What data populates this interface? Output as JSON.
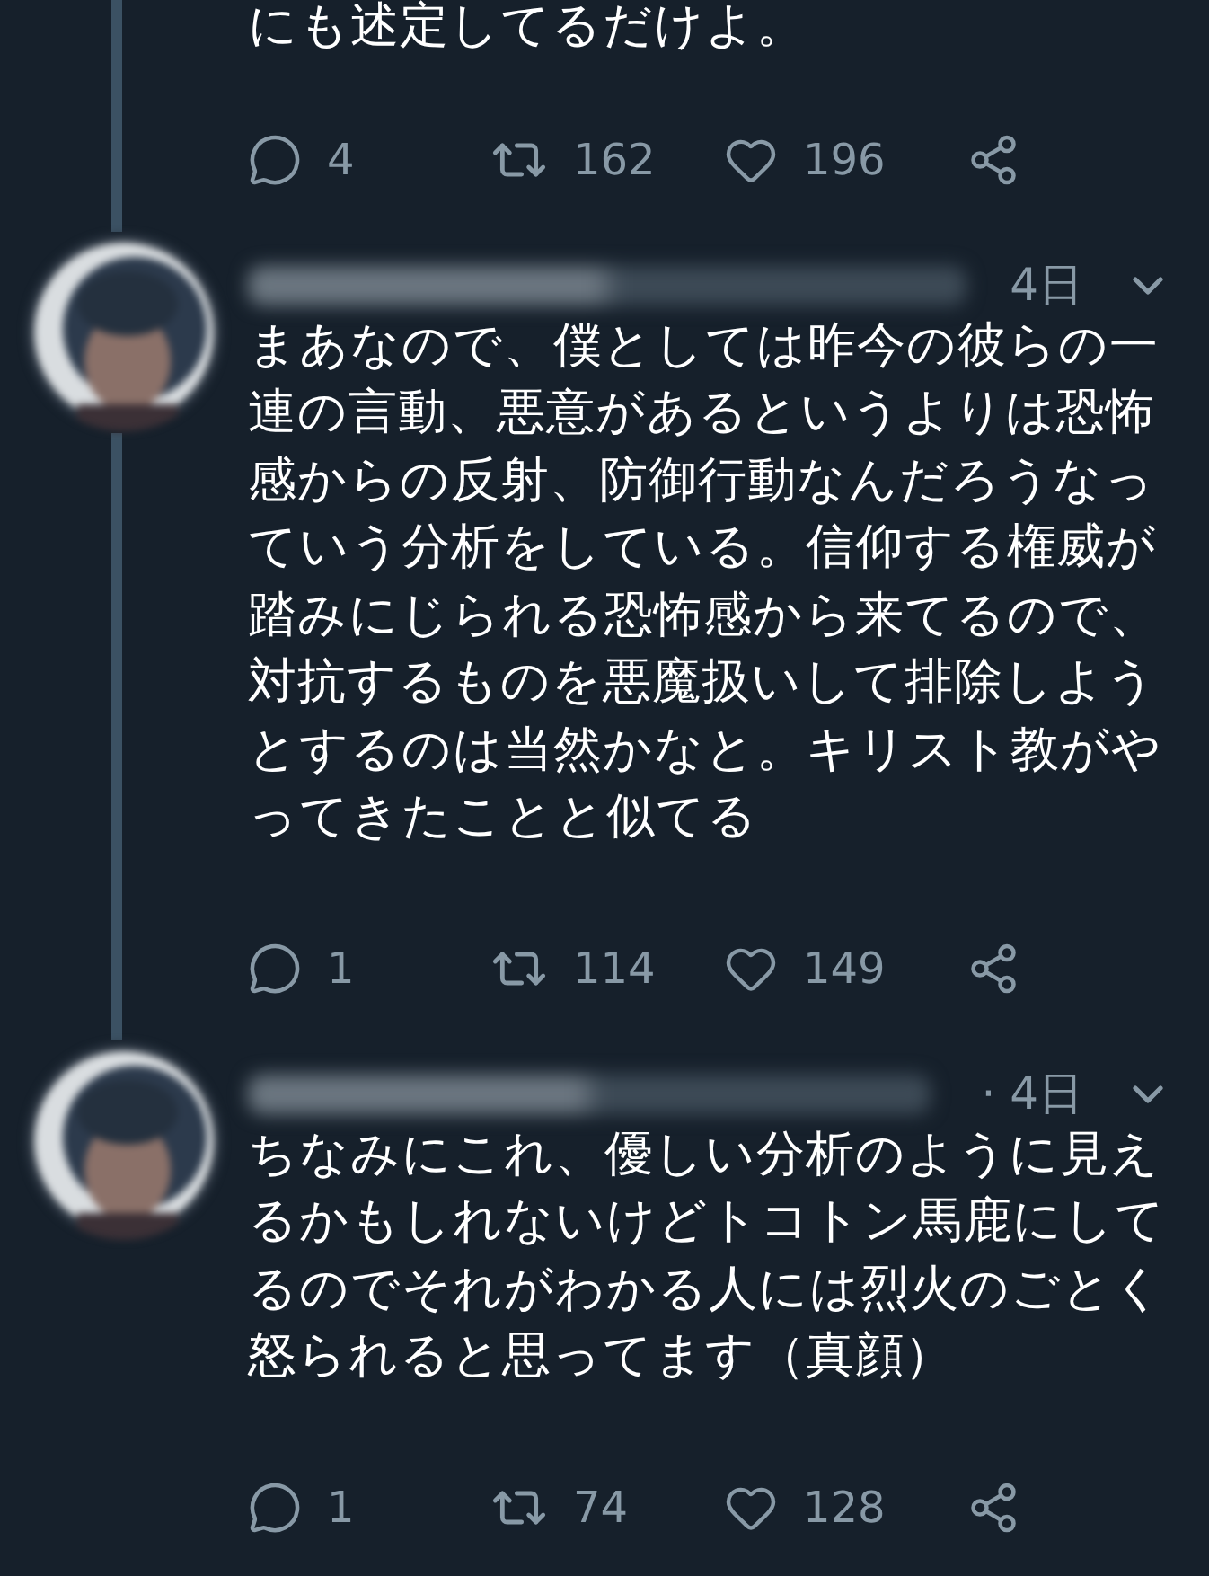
{
  "tweets": [
    {
      "text": "にも述定してるだけよ。",
      "connected_below": true,
      "actions": {
        "replies": "4",
        "retweets": "162",
        "likes": "196"
      }
    },
    {
      "time": "4日",
      "text": "まあなので、僕としては昨今の彼らの一連の言動、悪意があるというよりは恐怖感からの反射、防御行動なんだろうなっていう分析をしている。信仰する権威が踏みにじられる恐怖感から来てるので、対抗するものを悪魔扱いして排除しようとするのは当然かなと。キリスト教がやってきたことと似てる",
      "connected_below": true,
      "actions": {
        "replies": "1",
        "retweets": "114",
        "likes": "149"
      }
    },
    {
      "time": "· 4日",
      "text": "ちなみにこれ、優しい分析のように見えるかもしれないけどトコトン馬鹿にしてるのでそれがわかる人には烈火のごとく怒られると思ってます（真顔）",
      "connected_below": false,
      "actions": {
        "replies": "1",
        "retweets": "74",
        "likes": "128"
      }
    }
  ]
}
